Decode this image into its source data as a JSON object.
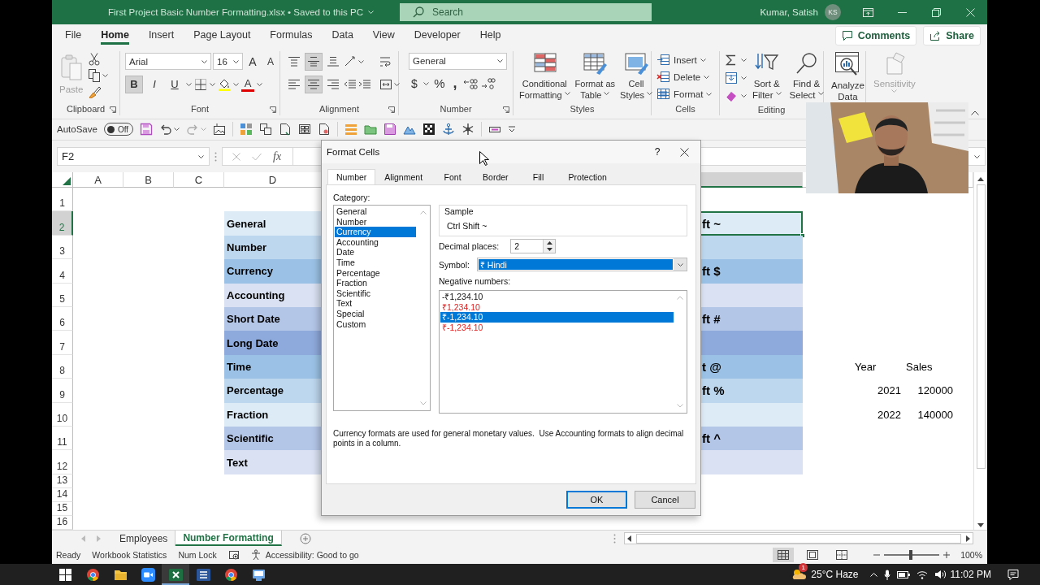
{
  "window": {
    "title": "First Project Basic Number Formatting.xlsx • Saved to this PC",
    "search": {
      "placeholder": "Search"
    },
    "user": "Kumar, Satish",
    "avatar": "KS"
  },
  "menu_tabs": [
    {
      "label": "File",
      "selected": false
    },
    {
      "label": "Home",
      "selected": true
    },
    {
      "label": "Insert",
      "selected": false
    },
    {
      "label": "Page Layout",
      "selected": false
    },
    {
      "label": "Formulas",
      "selected": false
    },
    {
      "label": "Data",
      "selected": false
    },
    {
      "label": "View",
      "selected": false
    },
    {
      "label": "Developer",
      "selected": false
    },
    {
      "label": "Help",
      "selected": false
    }
  ],
  "header_buttons": [
    "Comments",
    "Share"
  ],
  "ribbon": {
    "clipboard": {
      "label": "Clipboard",
      "paste": "Paste",
      "paste_disabled": true
    },
    "font": {
      "label": "Font",
      "family": "Arial",
      "size": "16",
      "size_buttons": [
        "A",
        "A"
      ],
      "styles": [
        {
          "label": "B",
          "pressed": true
        },
        {
          "label": "I",
          "pressed": false
        },
        {
          "label": "U",
          "pressed": false
        }
      ],
      "color_button": "A"
    },
    "alignment": {
      "label": "Alignment",
      "vertical": [
        {
          "kind": "top",
          "selected": false
        },
        {
          "kind": "middle",
          "selected": true
        },
        {
          "kind": "bottom",
          "selected": false
        }
      ],
      "horizontal": [
        {
          "kind": "left",
          "selected": false
        },
        {
          "kind": "center",
          "selected": true
        },
        {
          "kind": "right",
          "selected": false
        }
      ]
    },
    "number": {
      "label": "Number",
      "format": "General",
      "symbols": [
        "$",
        "%",
        ","
      ]
    },
    "styles": {
      "label": "Styles",
      "buttons": [
        [
          "Conditional",
          "Formatting"
        ],
        [
          "Format as",
          "Table"
        ],
        [
          "Cell",
          "Styles"
        ]
      ]
    },
    "cells": {
      "label": "Cells",
      "buttons": [
        "Insert",
        "Delete",
        "Format"
      ]
    },
    "editing": {
      "label": "Editing",
      "buttons": [
        [
          "Sort &",
          "Filter"
        ],
        [
          "Find &",
          "Select"
        ]
      ]
    },
    "analyze": [
      "Analyze",
      "Data"
    ],
    "sensitivity": {
      "label": "Sensitivity",
      "disabled": true
    }
  },
  "quick_access": {
    "autosave": "AutoSave",
    "autosave_on": false,
    "toggle_text": "Off"
  },
  "formula_bar": {
    "name_box": "F2",
    "function_label": "fx"
  },
  "sheet": {
    "columns": [
      "A",
      "B",
      "C",
      "D"
    ],
    "rows": [
      {
        "number": "1"
      },
      {
        "number": "2",
        "label": "General",
        "shortcut": "ft ~",
        "color": "#ddebf7",
        "selected": true
      },
      {
        "number": "3",
        "label": "Number",
        "color": "#bdd7ee",
        "selected": false
      },
      {
        "number": "4",
        "label": "Currency",
        "shortcut": "ft $",
        "color": "#9bc2e6",
        "selected": false
      },
      {
        "number": "5",
        "label": "Accounting",
        "color": "#d9e1f2",
        "selected": false
      },
      {
        "number": "6",
        "label": "Short Date",
        "shortcut": "ft #",
        "color": "#b4c6e7",
        "selected": false
      },
      {
        "number": "7",
        "label": "Long Date",
        "color": "#8ea9db",
        "selected": false
      },
      {
        "number": "8",
        "label": "Time",
        "shortcut": "t @",
        "color": "#9bc2e6",
        "selected": false,
        "side": {
          "kind": "header",
          "cells": [
            "Year",
            "Sales"
          ]
        }
      },
      {
        "number": "9",
        "label": "Percentage",
        "shortcut": "ft %",
        "color": "#bdd7ee",
        "selected": false,
        "side": {
          "kind": "value",
          "cells": [
            "2021",
            "120000"
          ]
        }
      },
      {
        "number": "10",
        "label": "Fraction",
        "color": "#ddebf7",
        "selected": false,
        "side": {
          "kind": "value",
          "cells": [
            "2022",
            "140000"
          ]
        }
      },
      {
        "number": "11",
        "label": "Scientific",
        "shortcut": "ft ^",
        "color": "#b4c6e7",
        "selected": false
      },
      {
        "number": "12",
        "label": "Text",
        "color": "#d9e1f2",
        "selected": false
      },
      {
        "number": "13"
      },
      {
        "number": "14"
      },
      {
        "number": "15"
      },
      {
        "number": "16"
      }
    ]
  },
  "sheet_tabs": [
    {
      "label": "Employees",
      "selected": false
    },
    {
      "label": "Number Formatting",
      "selected": true
    }
  ],
  "status_bar": {
    "items": [
      "Ready",
      "Workbook Statistics",
      "Num Lock"
    ],
    "accessibility": "Accessibility: Good to go",
    "views": [
      {
        "kind": "normal",
        "selected": true
      },
      {
        "kind": "page-layout",
        "selected": false
      },
      {
        "kind": "page-break",
        "selected": false
      }
    ],
    "zoom": {
      "level": 0.48,
      "reading": "100%"
    }
  },
  "taskbar": {
    "apps": [
      {
        "kind": "start",
        "active": false
      },
      {
        "kind": "browser",
        "active": false
      },
      {
        "kind": "folder",
        "active": false
      },
      {
        "kind": "video",
        "active": false
      },
      {
        "kind": "spreadsheet",
        "active": true
      },
      {
        "kind": "document",
        "active": false
      },
      {
        "kind": "browser",
        "active": false
      },
      {
        "kind": "app",
        "active": false
      }
    ],
    "weather": {
      "badge": "1",
      "text": "25°C Haze"
    },
    "time": "11:02 PM"
  },
  "dialog": {
    "title": "Format Cells",
    "help": "?",
    "tabs": [
      {
        "label": "Number",
        "selected": true
      },
      {
        "label": "Alignment",
        "selected": false
      },
      {
        "label": "Font",
        "selected": false
      },
      {
        "label": "Border",
        "selected": false
      },
      {
        "label": "Fill",
        "selected": false
      },
      {
        "label": "Protection",
        "selected": false
      }
    ],
    "category_label": "Category:",
    "categories": [
      {
        "label": "General",
        "selected": false
      },
      {
        "label": "Number",
        "selected": false
      },
      {
        "label": "Currency",
        "selected": true
      },
      {
        "label": "Accounting",
        "selected": false
      },
      {
        "label": "Date",
        "selected": false
      },
      {
        "label": "Time",
        "selected": false
      },
      {
        "label": "Percentage",
        "selected": false
      },
      {
        "label": "Fraction",
        "selected": false
      },
      {
        "label": "Scientific",
        "selected": false
      },
      {
        "label": "Text",
        "selected": false
      },
      {
        "label": "Special",
        "selected": false
      },
      {
        "label": "Custom",
        "selected": false
      }
    ],
    "sample_label": "Sample",
    "sample": "Ctrl Shift ~",
    "decimal_label": "Decimal places:",
    "decimal_value": "2",
    "symbol_label": "Symbol:",
    "symbol": "₹ Hindi",
    "negative_label": "Negative numbers:",
    "negative": [
      {
        "label": "-₹1,234.10",
        "red": false,
        "selected": false
      },
      {
        "label": "₹1,234.10",
        "red": true,
        "selected": false
      },
      {
        "label": "₹-1,234.10",
        "red": false,
        "selected": true
      },
      {
        "label": "₹-1,234.10",
        "red": true,
        "selected": false
      }
    ],
    "description": "Currency formats are used for general monetary values.  Use Accounting formats to align decimal points in a column.",
    "buttons": [
      {
        "label": "OK",
        "default": true
      },
      {
        "label": "Cancel",
        "default": false
      }
    ]
  }
}
